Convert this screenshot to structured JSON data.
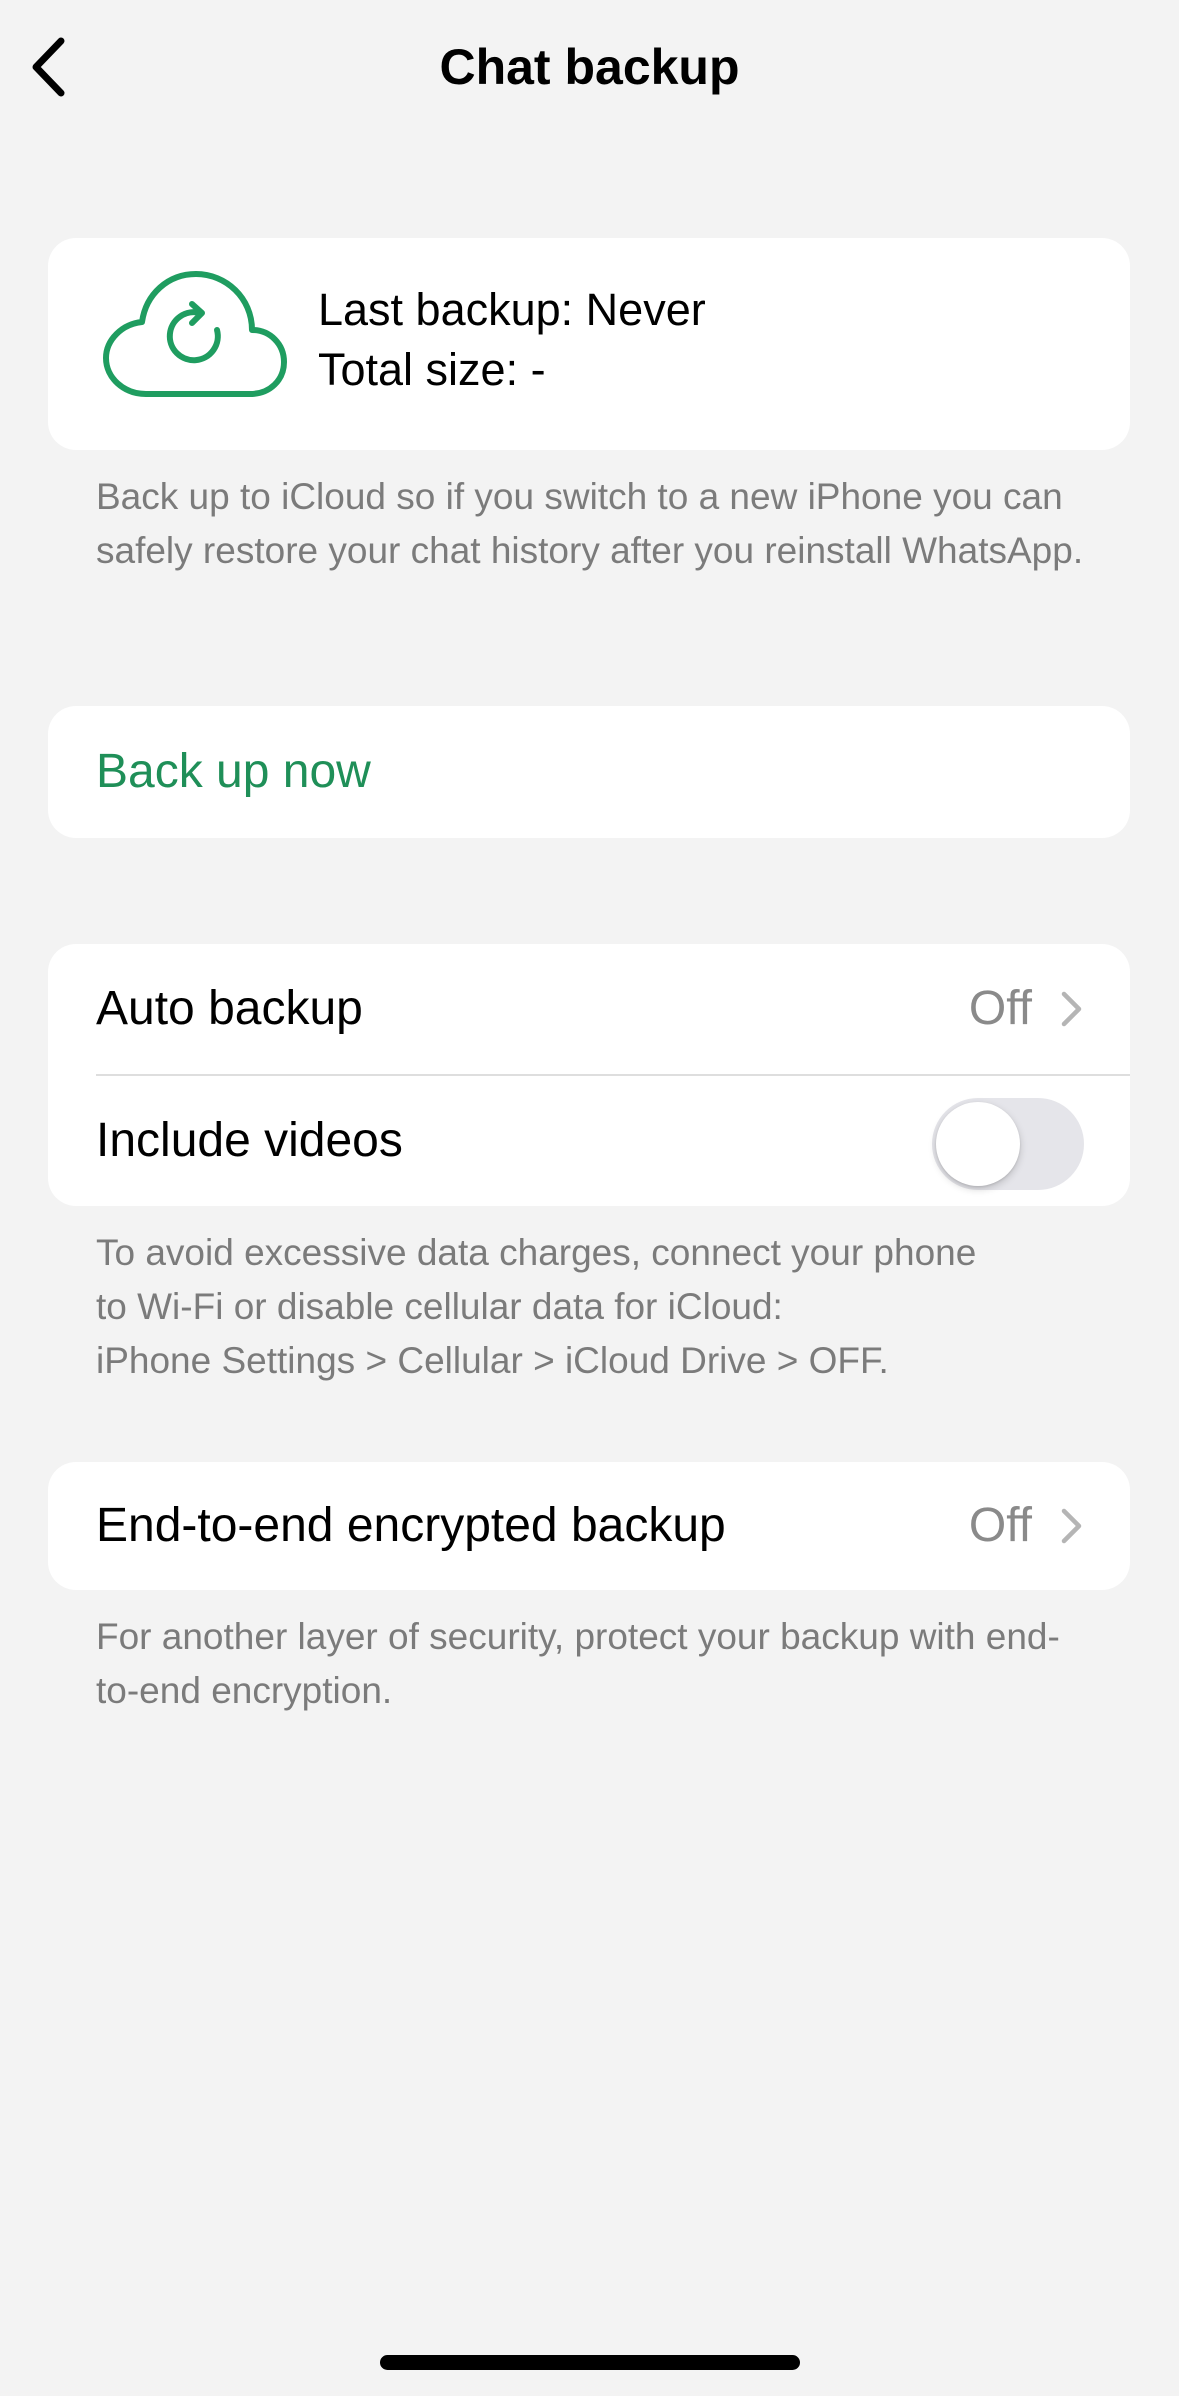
{
  "header": {
    "title": "Chat backup",
    "back_icon": "chevron-left-icon"
  },
  "backup_status": {
    "icon": "cloud-sync-icon",
    "last_backup": "Last backup: Never",
    "total_size": "Total size: -",
    "description": "Back up to iCloud so if you switch to a new iPhone you can safely restore your chat history after you reinstall WhatsApp."
  },
  "actions": {
    "back_up_now": "Back up now"
  },
  "settings": {
    "auto_backup_label": "Auto backup",
    "auto_backup_value": "Off",
    "include_videos_label": "Include videos",
    "include_videos_enabled": false,
    "description_line1": "To avoid excessive data charges, connect your phone",
    "description_line2": "to Wi-Fi or disable cellular data for iCloud:",
    "description_line3": "iPhone Settings > Cellular > iCloud Drive > OFF."
  },
  "encryption": {
    "label": "End-to-end encrypted backup",
    "value": "Off",
    "description": "For another layer of security, protect your backup with end-to-end encryption."
  },
  "colors": {
    "accent_green": "#1f8f58",
    "background": "#f3f3f3",
    "card": "#ffffff",
    "secondary_text": "#7b7b7b"
  }
}
